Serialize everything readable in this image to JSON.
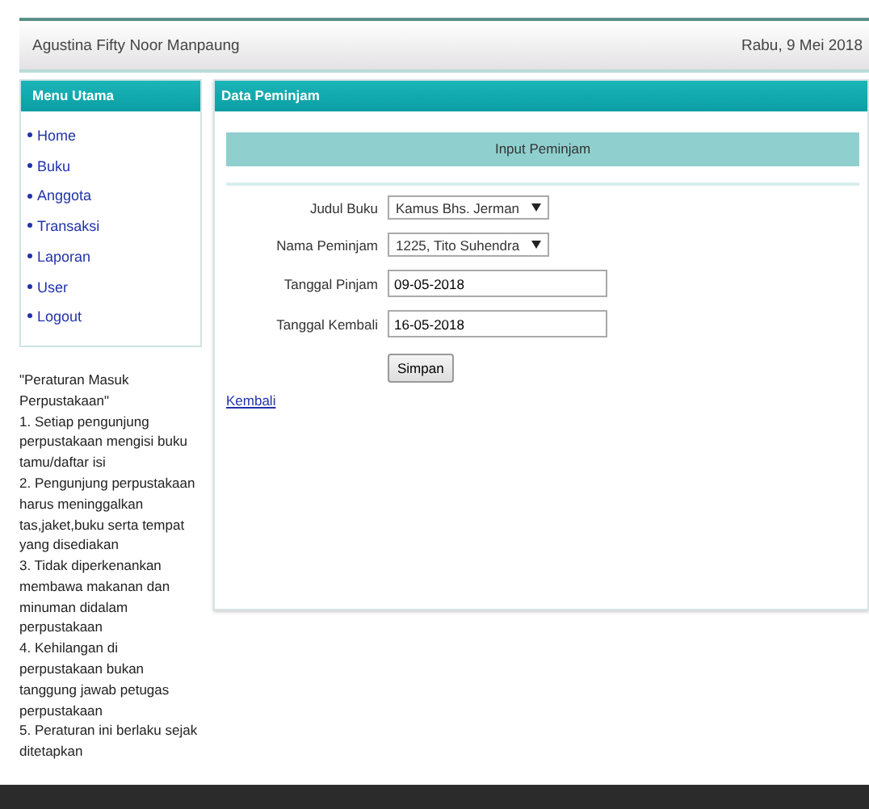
{
  "header": {
    "user": "Agustina Fifty Noor Manpaung",
    "date": "Rabu, 9 Mei 2018"
  },
  "sidebar": {
    "title": "Menu Utama",
    "items": [
      {
        "label": "Home"
      },
      {
        "label": "Buku"
      },
      {
        "label": "Anggota"
      },
      {
        "label": "Transaksi"
      },
      {
        "label": "Laporan"
      },
      {
        "label": "User"
      },
      {
        "label": "Logout"
      }
    ]
  },
  "rules": {
    "title": "\"Peraturan Masuk Perpustakaan\"",
    "items": [
      "1. Setiap pengunjung perpustakaan mengisi buku tamu/daftar isi",
      "2. Pengunjung perpustakaan harus meninggalkan tas,jaket,buku serta tempat yang disediakan",
      "3. Tidak diperkenankan membawa makanan dan minuman didalam perpustakaan",
      "4. Kehilangan di perpustakaan bukan tanggung jawab petugas perpustakaan",
      "5. Peraturan ini berlaku sejak ditetapkan"
    ]
  },
  "main": {
    "title": "Data Peminjam",
    "form_title": "Input Peminjam",
    "fields": [
      {
        "kind": "select",
        "label": "Judul Buku",
        "value": "Kamus Bhs. Jerman"
      },
      {
        "kind": "select",
        "label": "Nama Peminjam",
        "value": "1225, Tito Suhendra"
      },
      {
        "kind": "text",
        "label": "Tanggal Pinjam",
        "value": "09-05-2018"
      },
      {
        "kind": "text",
        "label": "Tanggal Kembali",
        "value": "16-05-2018"
      }
    ],
    "submit": "Simpan",
    "back_link": "Kembali"
  }
}
